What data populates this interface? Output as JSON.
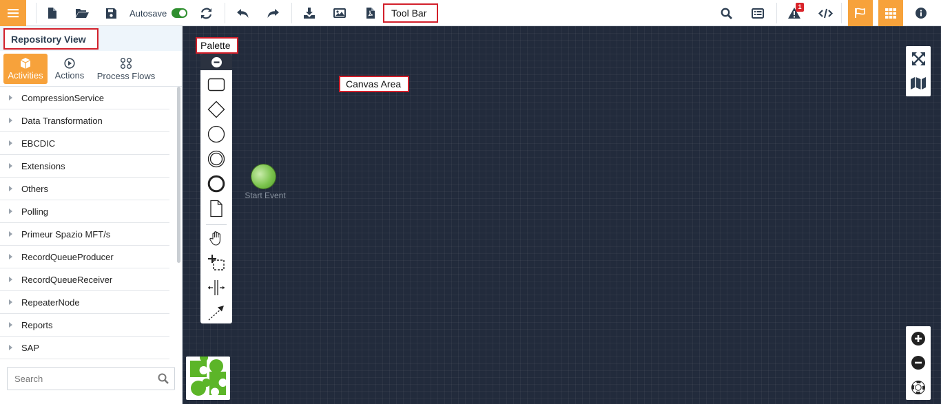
{
  "toolbar": {
    "autosave_label": "Autosave",
    "annotation": "Tool Bar",
    "notification_count": "1"
  },
  "sidebar": {
    "annotation": "Repository View",
    "tabs": [
      {
        "label": "Activities",
        "icon": "cube-icon",
        "active": true
      },
      {
        "label": "Actions",
        "icon": "play-circle-icon",
        "active": false
      },
      {
        "label": "Process Flows",
        "icon": "process-flows-icon",
        "active": false
      }
    ],
    "tree_items": [
      "CompressionService",
      "Data Transformation",
      "EBCDIC",
      "Extensions",
      "Others",
      "Polling",
      "Primeur Spazio MFT/s",
      "RecordQueueProducer",
      "RecordQueueReceiver",
      "RepeaterNode",
      "Reports",
      "SAP"
    ],
    "search": {
      "placeholder": "Search"
    }
  },
  "canvas": {
    "palette_annotation": "Palette",
    "canvas_annotation": "Canvas Area",
    "start_event_label": "Start Event"
  },
  "colors": {
    "accent": "#f7a23b",
    "canvas_bg": "#222b3c",
    "toggle_on": "#2f8f2f",
    "badge": "#d9232a",
    "annotation_border": "#d21f2a",
    "logo_green": "#5cb528"
  }
}
